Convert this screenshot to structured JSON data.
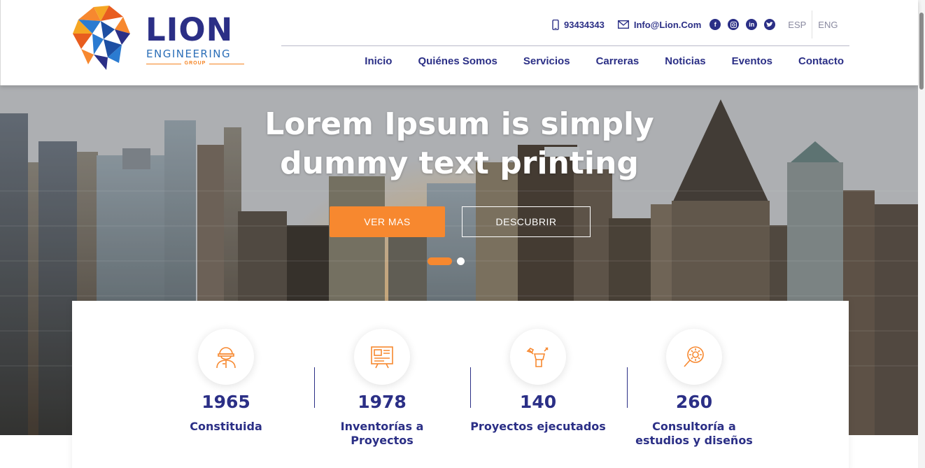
{
  "brand": {
    "name_part1": "LI",
    "name_part2": "ON",
    "subtitle": "ENGINEERING",
    "group": "GROUP"
  },
  "topbar": {
    "phone": "93434343",
    "email": "Info@Lion.Com",
    "social_icons": [
      "facebook-icon",
      "instagram-icon",
      "linkedin-icon",
      "twitter-icon"
    ],
    "languages": [
      "ESP",
      "ENG"
    ]
  },
  "nav": {
    "items": [
      "Inicio",
      "Quiénes Somos",
      "Servicios",
      "Carreras",
      "Noticias",
      "Eventos",
      "Contacto"
    ]
  },
  "hero": {
    "title_line1": "Lorem Ipsum is simply",
    "title_line2": "dummy text printing",
    "primary_button": "VER MAS",
    "secondary_button": "DESCUBRIR",
    "slides_total": 2,
    "active_slide": 1
  },
  "stats": [
    {
      "icon": "worker-icon",
      "value": "1965",
      "label": "Constituida"
    },
    {
      "icon": "blueprint-icon",
      "value": "1978",
      "label_line1": "Inventorías a",
      "label_line2": "Proyectos"
    },
    {
      "icon": "tools-icon",
      "value": "140",
      "label": "Proyectos ejecutados"
    },
    {
      "icon": "gear-search-icon",
      "value": "260",
      "label_line1": "Consultoría a",
      "label_line2": "estudios y diseños"
    }
  ],
  "colors": {
    "primary": "#2b2f86",
    "accent": "#f7882f"
  }
}
